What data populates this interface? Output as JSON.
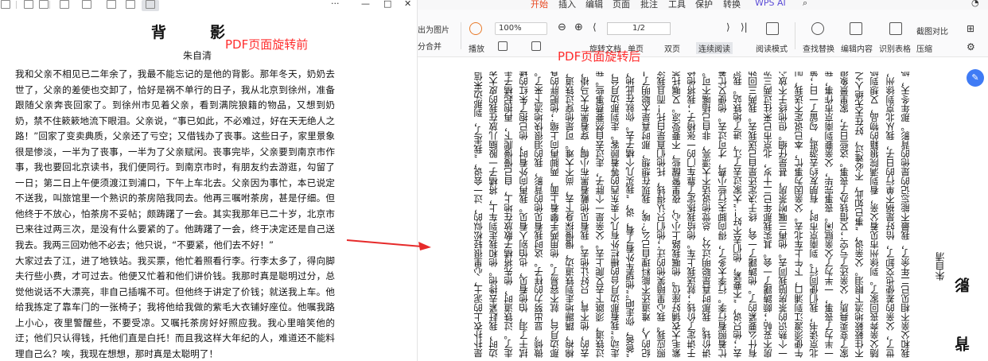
{
  "left": {
    "toolbar": {
      "window_controls": [
        "—",
        "□",
        "✕"
      ]
    },
    "document": {
      "title": "背　影",
      "author": "朱自清",
      "body": "我和父亲不相见已二年余了，我最不能忘记的是他的背影。那年冬天，奶奶去世了，父亲的差使也交卸了，恰好是祸不单行的日子，我从北京到徐州，准备跟随父亲奔丧回家了。到徐州市见着父亲，看到满院狼籍的物品，又想到奶奶，禁不住簌簌地流下眼泪。父亲说，“事已如此，不必难过，好在天无绝人之路！”回家了变卖典质，父亲还了亏空；又借钱办了丧事。这些日子，家里景象很是惨淡，一半为了丧事，一半为了父亲赋闲。丧事完毕，父亲要到南京市作事，我也要回北京读书，我们便同行。到南京市时，有朋友约去游逛，勾留了一日；第二日上午便须渡江到浦口，下午上车北去。父亲因为事忙，本已说定不送我，叫旅馆里一个熟识的茶房陪我同去。他再三嘱咐茶房，甚是仔细。但他终于不放心，怕茶房不妥帖；颇踌躇了一会。其实我那年已二十岁，北京市已来往过两三次，是没有什么要紧的了。他踌躇了一会，终于决定还是自己送我去。我两三回劝他不必去；他只说，“不要紧，他们去不好！”\n大家过去了江，进了地铁站。我买票，他忙着照看行李。行李太多了，得向脚夫行些小费，才可过去。他便又忙着和他们讲价钱。我那时真是聪明过分，总觉他说话不大漂亮，非自己插嘴不可。但他终于讲定了价钱；就送我上车。他给我拣定了靠车门的一张椅子；我将他给我做的紫毛大衣铺好座位。他嘱我路上小心，夜里警醒些，不要受凉。又嘱托茶房好好照应我。我心里暗笑他的迂；他们只认得钱，托他们直是白托！而且我这样大年纪的人，难道还不能料理自己么？唉，我现在想想，那时真是太聪明了！",
      "annotation": "PDF页面旋转前"
    }
  },
  "right": {
    "menu": {
      "items": [
        "开始",
        "插入",
        "编辑",
        "页面",
        "批注",
        "工具",
        "保护",
        "转换"
      ],
      "active": "开始",
      "wps_ai": "WPS AI"
    },
    "ribbon": {
      "export_image": "出为图片",
      "split_merge": "分合并",
      "play": "播放",
      "zoom_value": "100%",
      "page_value": "1/2",
      "rotate_doc": "旋转文档",
      "single_page": "单页",
      "double_page": "双页",
      "continuous_read": "连续阅读",
      "read_mode": "阅读模式",
      "find_replace": "查找替换",
      "edit_content": "编辑内容",
      "recognize_table": "识别表格",
      "screenshot_compare": "截图对比",
      "compress": "压缩"
    },
    "annotation": "PDF页面旋转后",
    "document": {
      "title": "背　影",
      "author": "朱自清",
      "columns": [
        "我和父亲不相见已二年余了，我最不能忘记的是他的背影。那年冬天，奶奶去",
        "世了，父亲的差使也交卸了，恰好是祸不单行的日子，我从北京到徐州，准备跟",
        "随父亲奔丧回家了。到徐州市见着父亲，看到满院狼籍的物品，又想到奶奶，禁",
        "不住簌簌地流下眼泪。父亲说，“事已如此，不必难过，好在天无绝人之路！”回",
        "家了变卖典质，父亲还了亏空；又借钱办了丧事。这些日子，家里景象很是惨淡，",
        "一半为了丧事，一半为了父亲赋闲。丧事完毕，父亲要到南京市作事，我也要回",
        "北京读书，我们便同行。到南京市时，有朋友约去游逛，勾留了一日；第二日上",
        "午便须渡江到浦口，下午上车北去。父亲因为事忙，本已说定不送我，叫旅馆里",
        "一个熟识的茶房陪我同去。他再三嘱咐茶房，甚是仔细。但他终于不放心，怕茶",
        "房不妥帖；颇踌躇了一会。其实我那年已二十岁，北京市已来往过两三次，是没",
        "有什么要紧的了。他踌躇了一会，终于决定还是自己送我去。我两三回劝他不必",
        "去；他只说，“不要紧，他们去不好！”大家过去了江，进了地铁站。我买票，他",
        "忙着照看行李。行李太多了，得向脚夫行些小费，才可过去。他便又忙着和他们",
        "讲价钱。我那时真是聪明过分，总觉他说话不大漂亮，非自己插嘴不可。但他终",
        "于讲定了价钱；就送我上车。他给我拣定了靠车门的一张椅子；我将他给我做的",
        "紫毛大衣铺好座位。他嘱我路上小心，夜里警醒些，不要受凉。又嘱托茶房好好",
        "照应我。我心里暗笑他的迂；他们只认得钱，托他们直是白托！而且我这样大年",
        "纪的人，难道还不能料理自己么？唉，我现在想想，那时真是太聪明了！我说道，",
        "“爸爸，你走吧。”他望车外看了看，说，“我买几个橘子去。你就在此地，不要",
        "走动。”我看那边月台的栅栏外有几个卖东西的等着顾客。走到那边月台，须穿",
        "过铁道，须跳下去又爬上去。父亲是一个胖子，走过去自然要费事些。我本来要",
        "去的，他不肯，只好让他去。我看见他戴着黑布小帽，穿着黑布大马褂，深青布",
        "棉袍，蹒跚地走到铁道边，慢慢探身下去，尚不大难。可是他穿过铁道，要爬上",
        "那边月台，就不容易了。他用两手攀着上面，两脚再向上缩；他肥胖的身子向左",
        "微倾，显出努力的样子。这时我看见他的背影，我的泪很快地流下来了。我赶紧",
        "拭干了泪，怕他看见，也怕别人看见。我再向外看时，他已抱了朱红的橘子往回",
        "走了。过铁道时，他先将橘子散放在地上，自己慢慢爬下，再抱起橘子走。到这",
        "边时，我赶紧去搀他。他和我走到车上，将橘子一股脑儿放在我的皮大衣上。于",
        "是扑扑衣上的泥土，心里很轻松似的，过一会说，“我走了，到那边来信！”我望"
      ]
    },
    "fab_icon": "translate-icon"
  },
  "colors": {
    "annotation": "#ff2e2e",
    "menu_active": "#e8471f",
    "wps_ai": "#5a4bd6",
    "fab": "#3f7bf5"
  }
}
